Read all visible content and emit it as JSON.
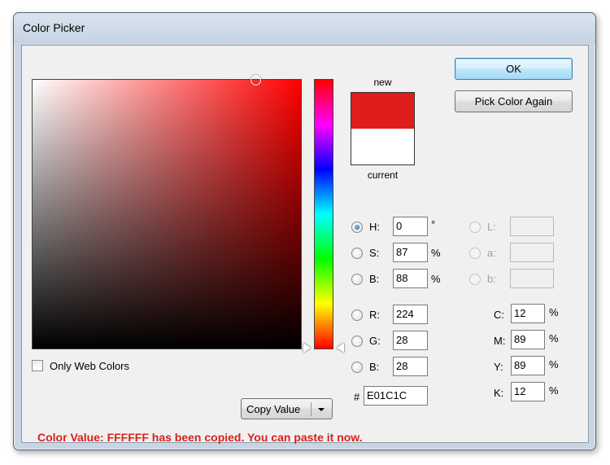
{
  "window": {
    "title": "Color Picker"
  },
  "buttons": {
    "ok": "OK",
    "pick_again": "Pick Color Again",
    "copy_value": "Copy Value"
  },
  "swatch": {
    "new_label": "new",
    "current_label": "current",
    "new_color": "#e01c1c",
    "current_color": "#ffffff"
  },
  "fields": {
    "hsb": [
      {
        "label": "H:",
        "value": "0",
        "unit": "°",
        "checked": true
      },
      {
        "label": "S:",
        "value": "87",
        "unit": "%",
        "checked": false
      },
      {
        "label": "B:",
        "value": "88",
        "unit": "%",
        "checked": false
      }
    ],
    "lab": [
      {
        "label": "L:",
        "value": ""
      },
      {
        "label": "a:",
        "value": ""
      },
      {
        "label": "b:",
        "value": ""
      }
    ],
    "rgb": [
      {
        "label": "R:",
        "value": "224"
      },
      {
        "label": "G:",
        "value": "28"
      },
      {
        "label": "B:",
        "value": "28"
      }
    ],
    "cmyk": [
      {
        "label": "C:",
        "value": "12",
        "unit": "%"
      },
      {
        "label": "M:",
        "value": "89",
        "unit": "%"
      },
      {
        "label": "Y:",
        "value": "89",
        "unit": "%"
      },
      {
        "label": "K:",
        "value": "12",
        "unit": "%"
      }
    ],
    "hex_label": "#",
    "hex_value": "E01C1C"
  },
  "only_web_colors": {
    "label": "Only Web Colors",
    "checked": false
  },
  "status": {
    "text": "Color Value: FFFFFF has been copied. You can paste it now.",
    "color": "#d8231d"
  }
}
